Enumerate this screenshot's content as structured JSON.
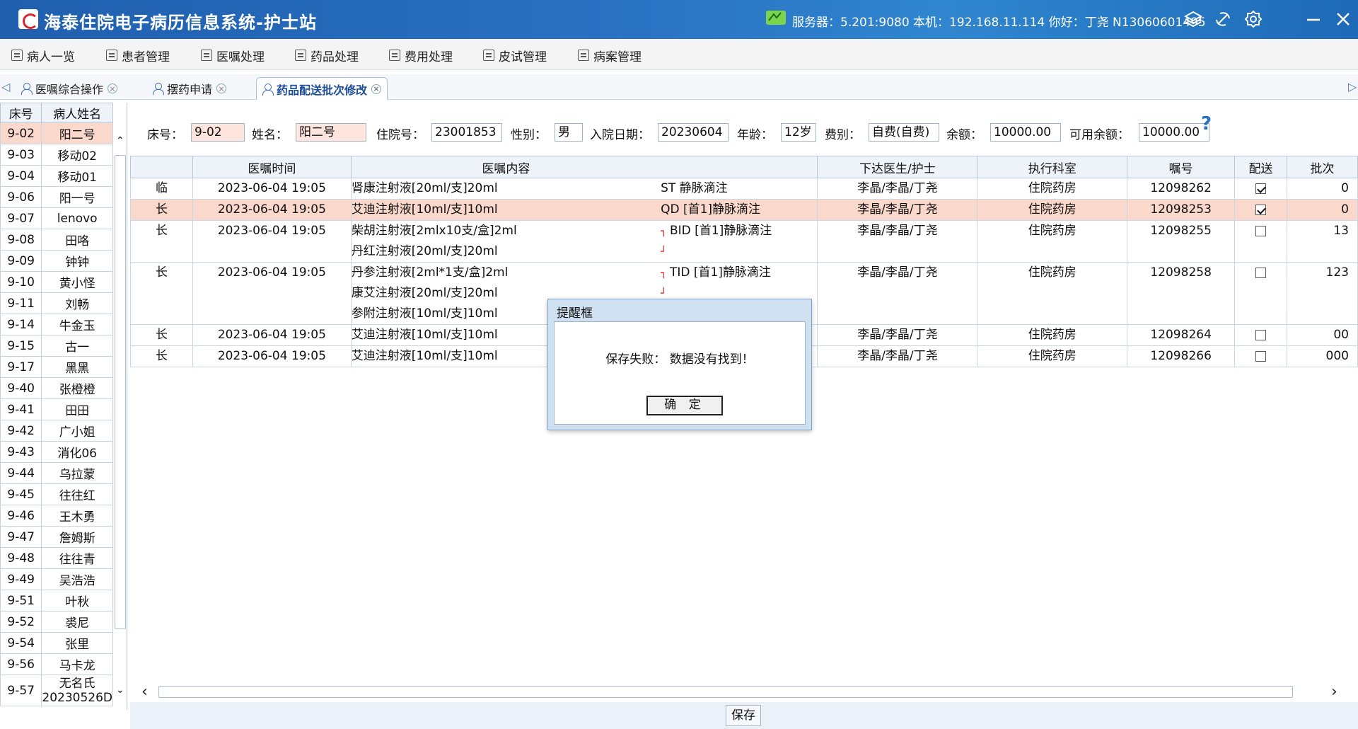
{
  "app": {
    "title": "海泰住院电子病历信息系统-护士站",
    "status_text": "服务器：5.201:9080 本机：192.168.11.114 你好：丁尧 N13060601495"
  },
  "menu": [
    "病人一览",
    "患者管理",
    "医嘱处理",
    "药品处理",
    "费用处理",
    "皮试管理",
    "病案管理"
  ],
  "tabs": [
    {
      "label": "医嘱综合操作",
      "active": false
    },
    {
      "label": "摆药申请",
      "active": false
    },
    {
      "label": "药品配送批次修改",
      "active": true
    }
  ],
  "patient_list": {
    "headers": [
      "床号",
      "病人姓名"
    ],
    "rows": [
      [
        "9-02",
        "阳二号"
      ],
      [
        "9-03",
        "移动02"
      ],
      [
        "9-04",
        "移动01"
      ],
      [
        "9-06",
        "阳一号"
      ],
      [
        "9-07",
        "lenovo"
      ],
      [
        "9-08",
        "田咯"
      ],
      [
        "9-09",
        "钟钟"
      ],
      [
        "9-10",
        "黄小怪"
      ],
      [
        "9-11",
        "刘畅"
      ],
      [
        "9-14",
        "牛金玉"
      ],
      [
        "9-15",
        "古一"
      ],
      [
        "9-17",
        "黑黑"
      ],
      [
        "9-40",
        "张橙橙"
      ],
      [
        "9-41",
        "田田"
      ],
      [
        "9-42",
        "广小姐"
      ],
      [
        "9-43",
        "消化06"
      ],
      [
        "9-44",
        "乌拉蒙"
      ],
      [
        "9-45",
        "往往红"
      ],
      [
        "9-46",
        "王木勇"
      ],
      [
        "9-47",
        "詹姆斯"
      ],
      [
        "9-48",
        "往往青"
      ],
      [
        "9-49",
        "吴浩浩"
      ],
      [
        "9-51",
        "叶秋"
      ],
      [
        "9-52",
        "裘尼"
      ],
      [
        "9-54",
        "张里"
      ],
      [
        "9-56",
        "马卡龙"
      ],
      [
        "9-57",
        "无名氏 20230526D"
      ]
    ],
    "selected_index": 0
  },
  "patient_info": {
    "bed_label": "床号：",
    "bed": "9-02",
    "name_label": "姓名：",
    "name": "阳二号",
    "inpatient_no_label": "住院号：",
    "inpatient_no": "23001853",
    "gender_label": "性别：",
    "gender": "男",
    "admit_label": "入院日期：",
    "admit_date": "20230604",
    "age_label": "年龄：",
    "age": "12岁",
    "fee_type_label": "费别：",
    "fee_type": "自费(自费)",
    "balance_label": "余额：",
    "balance": "10000.00",
    "avail_label": "可用余额：",
    "avail_balance": "10000.00",
    "help": "?"
  },
  "orders": {
    "headers": [
      "",
      "医嘱时间",
      "医嘱内容",
      "",
      "下达医生/护士",
      "执行科室",
      "嘱号",
      "配送",
      "批次"
    ],
    "rows": [
      {
        "type": "临",
        "time": "2023-06-04 19:05",
        "drugs": [
          "肾康注射液[20ml/支]20ml"
        ],
        "usage": "ST 静脉滴注",
        "bracket": false,
        "doctor": "李晶/李晶/丁尧",
        "dept": "住院药房",
        "order_no": "12098262",
        "deliver": true,
        "batch": "0",
        "highlight": false
      },
      {
        "type": "长",
        "time": "2023-06-04 19:05",
        "drugs": [
          "艾迪注射液[10ml/支]10ml"
        ],
        "usage": "QD [首1]静脉滴注",
        "bracket": false,
        "doctor": "李晶/李晶/丁尧",
        "dept": "住院药房",
        "order_no": "12098253",
        "deliver": true,
        "batch": "0",
        "highlight": true
      },
      {
        "type": "长",
        "time": "2023-06-04 19:05",
        "drugs": [
          "柴胡注射液[2mlx10支/盒]2ml",
          "丹红注射液[20ml/支]20ml"
        ],
        "usage": "BID [首1]静脉滴注",
        "bracket": true,
        "doctor": "李晶/李晶/丁尧",
        "dept": "住院药房",
        "order_no": "12098255",
        "deliver": false,
        "batch": "13",
        "highlight": false
      },
      {
        "type": "长",
        "time": "2023-06-04 19:05",
        "drugs": [
          "丹参注射液[2ml*1支/盒]2ml",
          "康艾注射液[20ml/支]20ml",
          "参附注射液[10ml/支]10ml"
        ],
        "usage": "TID [首1]静脉滴注",
        "bracket": true,
        "doctor": "李晶/李晶/丁尧",
        "dept": "住院药房",
        "order_no": "12098258",
        "deliver": false,
        "batch": "123",
        "highlight": false
      },
      {
        "type": "长",
        "time": "2023-06-04 19:05",
        "drugs": [
          "艾迪注射液[10ml/支]10ml"
        ],
        "usage": "",
        "bracket": false,
        "doctor": "李晶/李晶/丁尧",
        "dept": "住院药房",
        "order_no": "12098264",
        "deliver": false,
        "batch": "00",
        "highlight": false
      },
      {
        "type": "长",
        "time": "2023-06-04 19:05",
        "drugs": [
          "艾迪注射液[10ml/支]10ml"
        ],
        "usage": "",
        "bracket": false,
        "doctor": "李晶/李晶/丁尧",
        "dept": "住院药房",
        "order_no": "12098266",
        "deliver": false,
        "batch": "000",
        "highlight": false
      }
    ]
  },
  "footer": {
    "save_label": "保存"
  },
  "dialog": {
    "title": "提醒框",
    "message": "保存失败：  数据没有找到！",
    "ok_label": "确 定"
  },
  "icons": {
    "status": "network-status-icon",
    "layers": "layers-icon",
    "sync": "sync-icon",
    "settings": "gear-icon",
    "minimize": "minimize-icon",
    "close": "close-icon"
  }
}
